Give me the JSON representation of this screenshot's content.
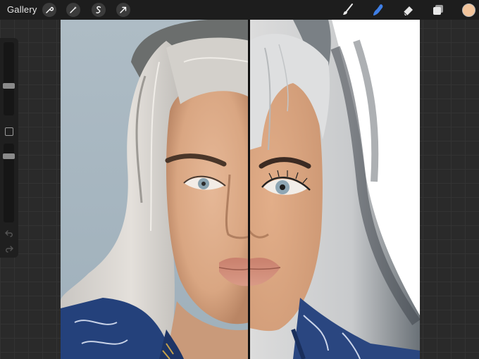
{
  "toolbar": {
    "gallery_label": "Gallery",
    "left_tools": [
      "wrench-icon",
      "magic-wand-icon",
      "selection-icon",
      "transform-arrow-icon"
    ],
    "right_tools": [
      "brush-icon",
      "smudge-icon",
      "eraser-icon",
      "layers-icon"
    ],
    "active_tool": "smudge-icon",
    "active_color": "#f2c49b",
    "active_tool_color": "#3f7fe6"
  },
  "sidebar": {
    "brush_size_level": 0.4,
    "opacity_level": 0.3
  },
  "canvas": {
    "background_color": "#a9b8c1",
    "drawing_background": "#ffffff",
    "skin_tone": "#dfab86",
    "divider_color": "#111111"
  }
}
